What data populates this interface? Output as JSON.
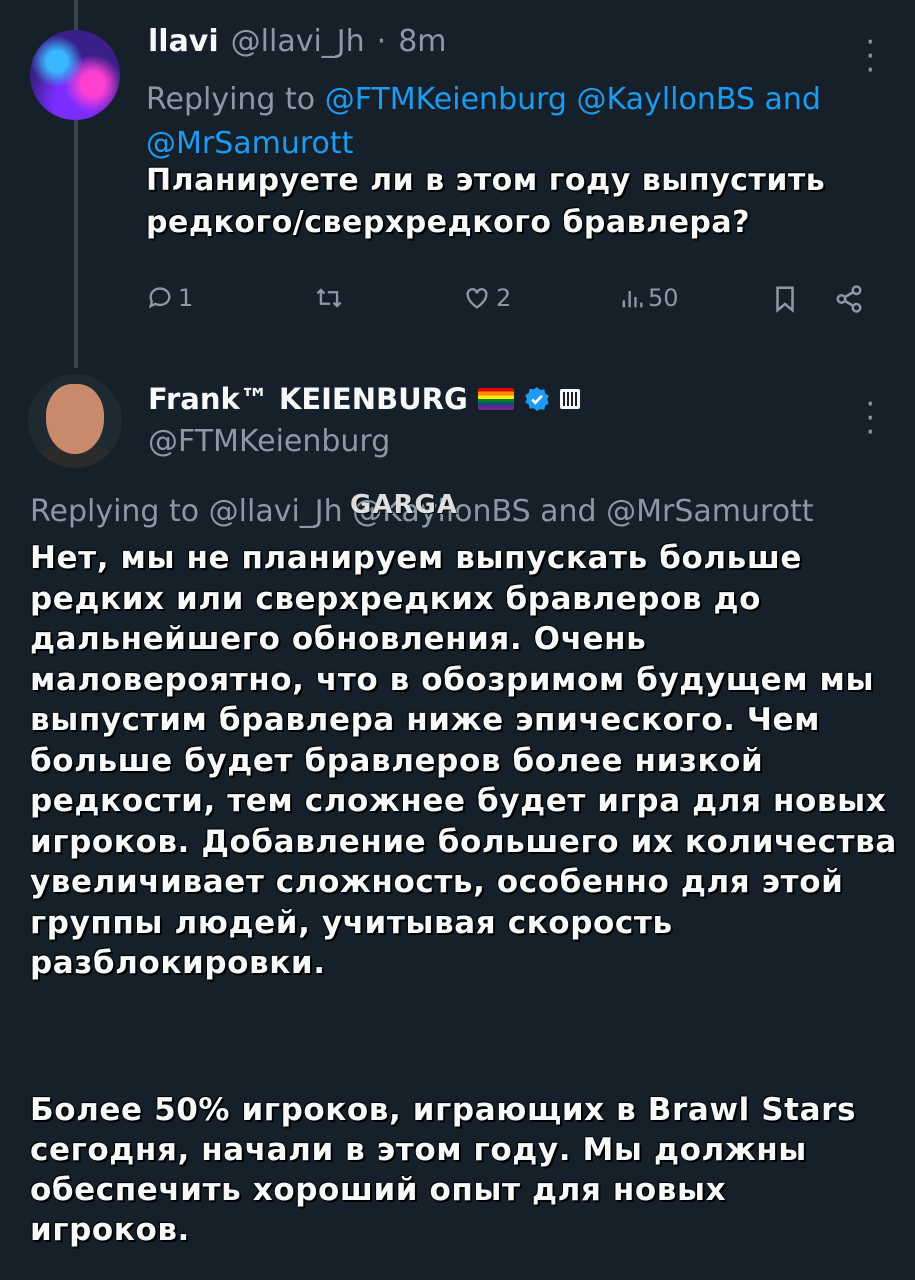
{
  "reply_tweet": {
    "name": "llavi",
    "handle": "@llavi_Jh",
    "separator": "·",
    "time": "8m",
    "replying_prefix": "Replying to",
    "mentions": [
      "@FTMKeienburg",
      "@KayllonBS"
    ],
    "and_word": "and",
    "last_mention": "@MrSamurott",
    "text": "Планируете ли в этом году выпустить редкого/сверхредкого бравлера?",
    "actions": {
      "reply_count": "1",
      "retweet_count": "",
      "like_count": "2",
      "views_count": "50"
    }
  },
  "main_tweet": {
    "name": "Frank™ KEIENBURG",
    "handle": "@FTMKeienburg",
    "replying_line": "Replying to @llavi_Jh @KayllonBS and @MrSamurott",
    "watermark": "GARGA",
    "paragraph1": "Нет, мы не планируем выпускать больше редких или сверхредких бравлеров до дальнейшего обновления. Очень маловероятно, что в обозримом будущем мы выпустим бравлера ниже эпического. Чем больше будет бравлеров более низкой редкости, тем сложнее будет игра для новых игроков. Добавление большего их количества увеличивает сложность, особенно для этой группы людей, учитывая скорость разблокировки.",
    "paragraph2": "Более 50% игроков, играющих в Brawl Stars сегодня, начали в этом году. Мы должны обеспечить хороший опыт для новых игроков."
  },
  "colors": {
    "background": "#15202b",
    "text": "#f7f9f9",
    "muted": "#8b98a5",
    "link": "#1d9bf0",
    "verified": "#1d9bf0"
  },
  "icons": [
    "more-icon",
    "reply-icon",
    "retweet-icon",
    "like-icon",
    "views-icon",
    "bookmark-icon",
    "share-icon",
    "verified-badge-icon",
    "pride-flag-icon",
    "affiliation-badge-icon"
  ]
}
